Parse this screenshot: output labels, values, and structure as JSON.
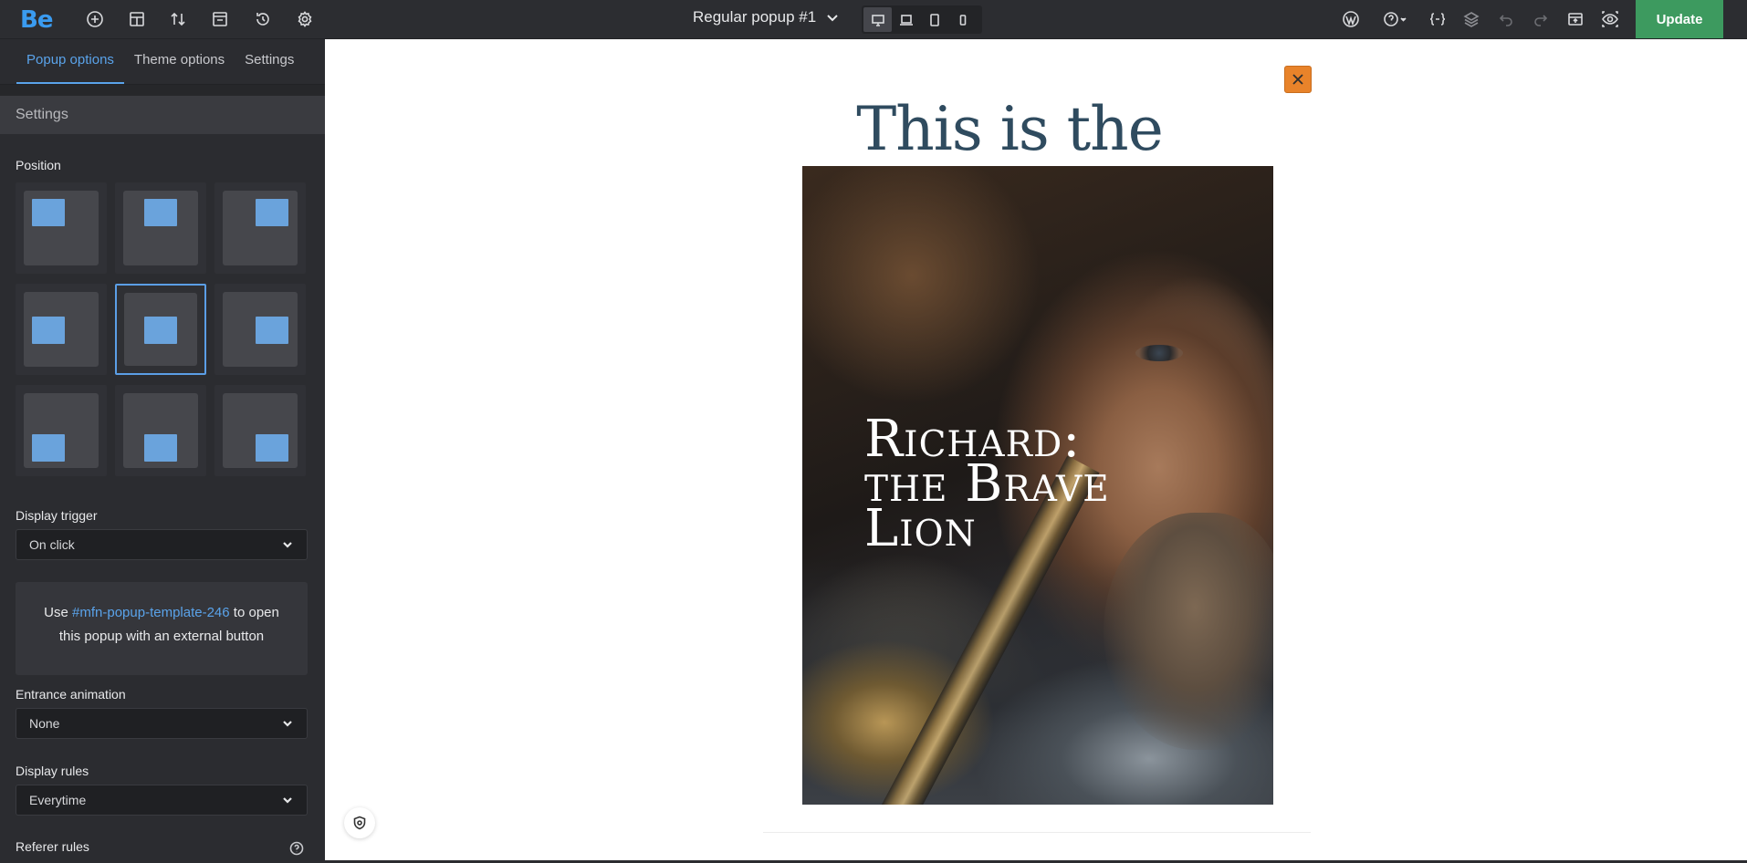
{
  "app": {
    "logo": "Be"
  },
  "header": {
    "popup_name": "Regular popup #1",
    "update_label": "Update",
    "left_icons": [
      "add-icon",
      "layout-icon",
      "sort-icon",
      "template-icon",
      "history-icon",
      "gear-icon"
    ],
    "right_icons": [
      "wordpress-icon",
      "help-icon",
      "code-icon",
      "layers-icon",
      "undo-icon",
      "redo-icon",
      "preview-icon",
      "visibility-icon"
    ],
    "devices": [
      "desktop",
      "laptop",
      "tablet",
      "mobile"
    ],
    "active_device": "desktop"
  },
  "sidebar": {
    "tabs": [
      {
        "label": "Popup options",
        "active": true
      },
      {
        "label": "Theme options",
        "active": false
      },
      {
        "label": "Settings",
        "active": false
      }
    ],
    "section_title": "Settings",
    "position_label": "Position",
    "positions": [
      "top-left",
      "top-center",
      "top-right",
      "center-left",
      "center",
      "center-right",
      "bottom-left",
      "bottom-center",
      "bottom-right"
    ],
    "active_position": "center",
    "display_trigger_label": "Display trigger",
    "display_trigger_value": "On click",
    "info_prefix": "Use",
    "info_link": "#mfn-popup-template-246",
    "info_suffix": "to open this popup with an external button",
    "entrance_animation_label": "Entrance animation",
    "entrance_animation_value": "None",
    "display_rules_label": "Display rules",
    "display_rules_value": "Everytime",
    "referer_rules_label": "Referer rules"
  },
  "canvas": {
    "heading": "This is the popup",
    "poster_title_lines": [
      "Richard:",
      "the Brave",
      "Lion"
    ],
    "accent_close_color": "#e8832a"
  }
}
